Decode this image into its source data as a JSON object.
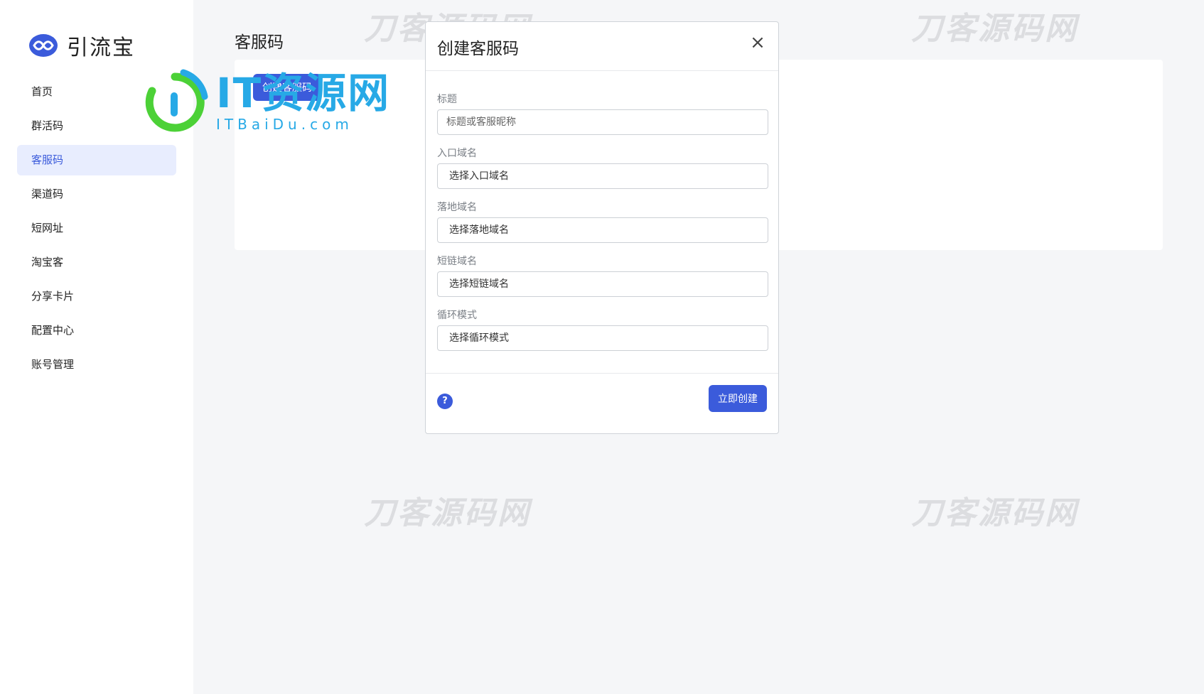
{
  "app": {
    "name": "引流宝",
    "accent": "#3b5bdb"
  },
  "sidebar": {
    "items": [
      {
        "label": "首页"
      },
      {
        "label": "群活码"
      },
      {
        "label": "客服码",
        "active": true
      },
      {
        "label": "渠道码"
      },
      {
        "label": "短网址"
      },
      {
        "label": "淘宝客"
      },
      {
        "label": "分享卡片"
      },
      {
        "label": "配置中心"
      },
      {
        "label": "账号管理"
      }
    ]
  },
  "main": {
    "page_title": "客服码",
    "create_button": "创建客服码"
  },
  "watermarks": [
    "刀客源码网",
    "刀客源码网",
    "刀客源码网",
    "刀客源码网"
  ],
  "overlay_badge": {
    "main": "IT资源网",
    "sub": "ITBaiDu.com"
  },
  "modal": {
    "title": "创建客服码",
    "close_symbol": "×",
    "fields": [
      {
        "label": "标题",
        "placeholder": "标题或客服昵称"
      },
      {
        "label": "入口域名",
        "value": "选择入口域名"
      },
      {
        "label": "落地域名",
        "value": "选择落地域名"
      },
      {
        "label": "短链域名",
        "value": "选择短链域名"
      },
      {
        "label": "循环模式",
        "value": "选择循环模式"
      }
    ],
    "help_symbol": "?",
    "submit_label": "立即创建"
  }
}
